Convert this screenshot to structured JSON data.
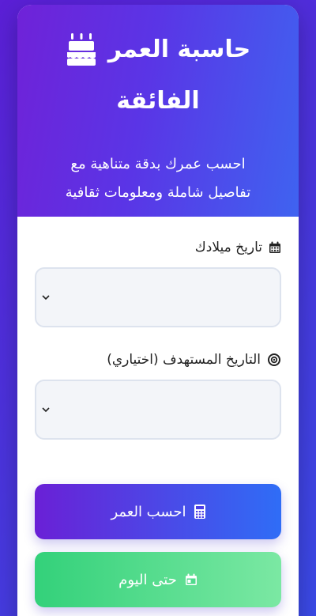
{
  "header": {
    "title_line1": "حاسبة العمر",
    "title_line2": "الفائقة",
    "subtitle_line1": "احسب عمرك بدقة متناهية مع",
    "subtitle_line2": "تفاصيل شاملة ومعلومات ثقافية",
    "icon": "birthday-cake-icon"
  },
  "form": {
    "birth_date_label": "تاريخ ميلادك",
    "birth_date_icon": "calendar-icon",
    "birth_date_value": "",
    "target_date_label": "التاريخ المستهدف (اختياري)",
    "target_date_icon": "target-icon",
    "target_date_value": ""
  },
  "buttons": {
    "calculate_label": "احسب العمر",
    "calculate_icon": "calculator-icon",
    "today_label": "حتى اليوم",
    "today_icon": "calendar-day-icon"
  },
  "colors": {
    "background": "#4a34dc",
    "header_gradient_start": "#6f22d8",
    "header_gradient_end": "#3f63f0",
    "calculate_button_start": "#6a20d6",
    "calculate_button_end": "#2f6df6",
    "today_button_start": "#33d17a",
    "today_button_end": "#7be8a3"
  }
}
